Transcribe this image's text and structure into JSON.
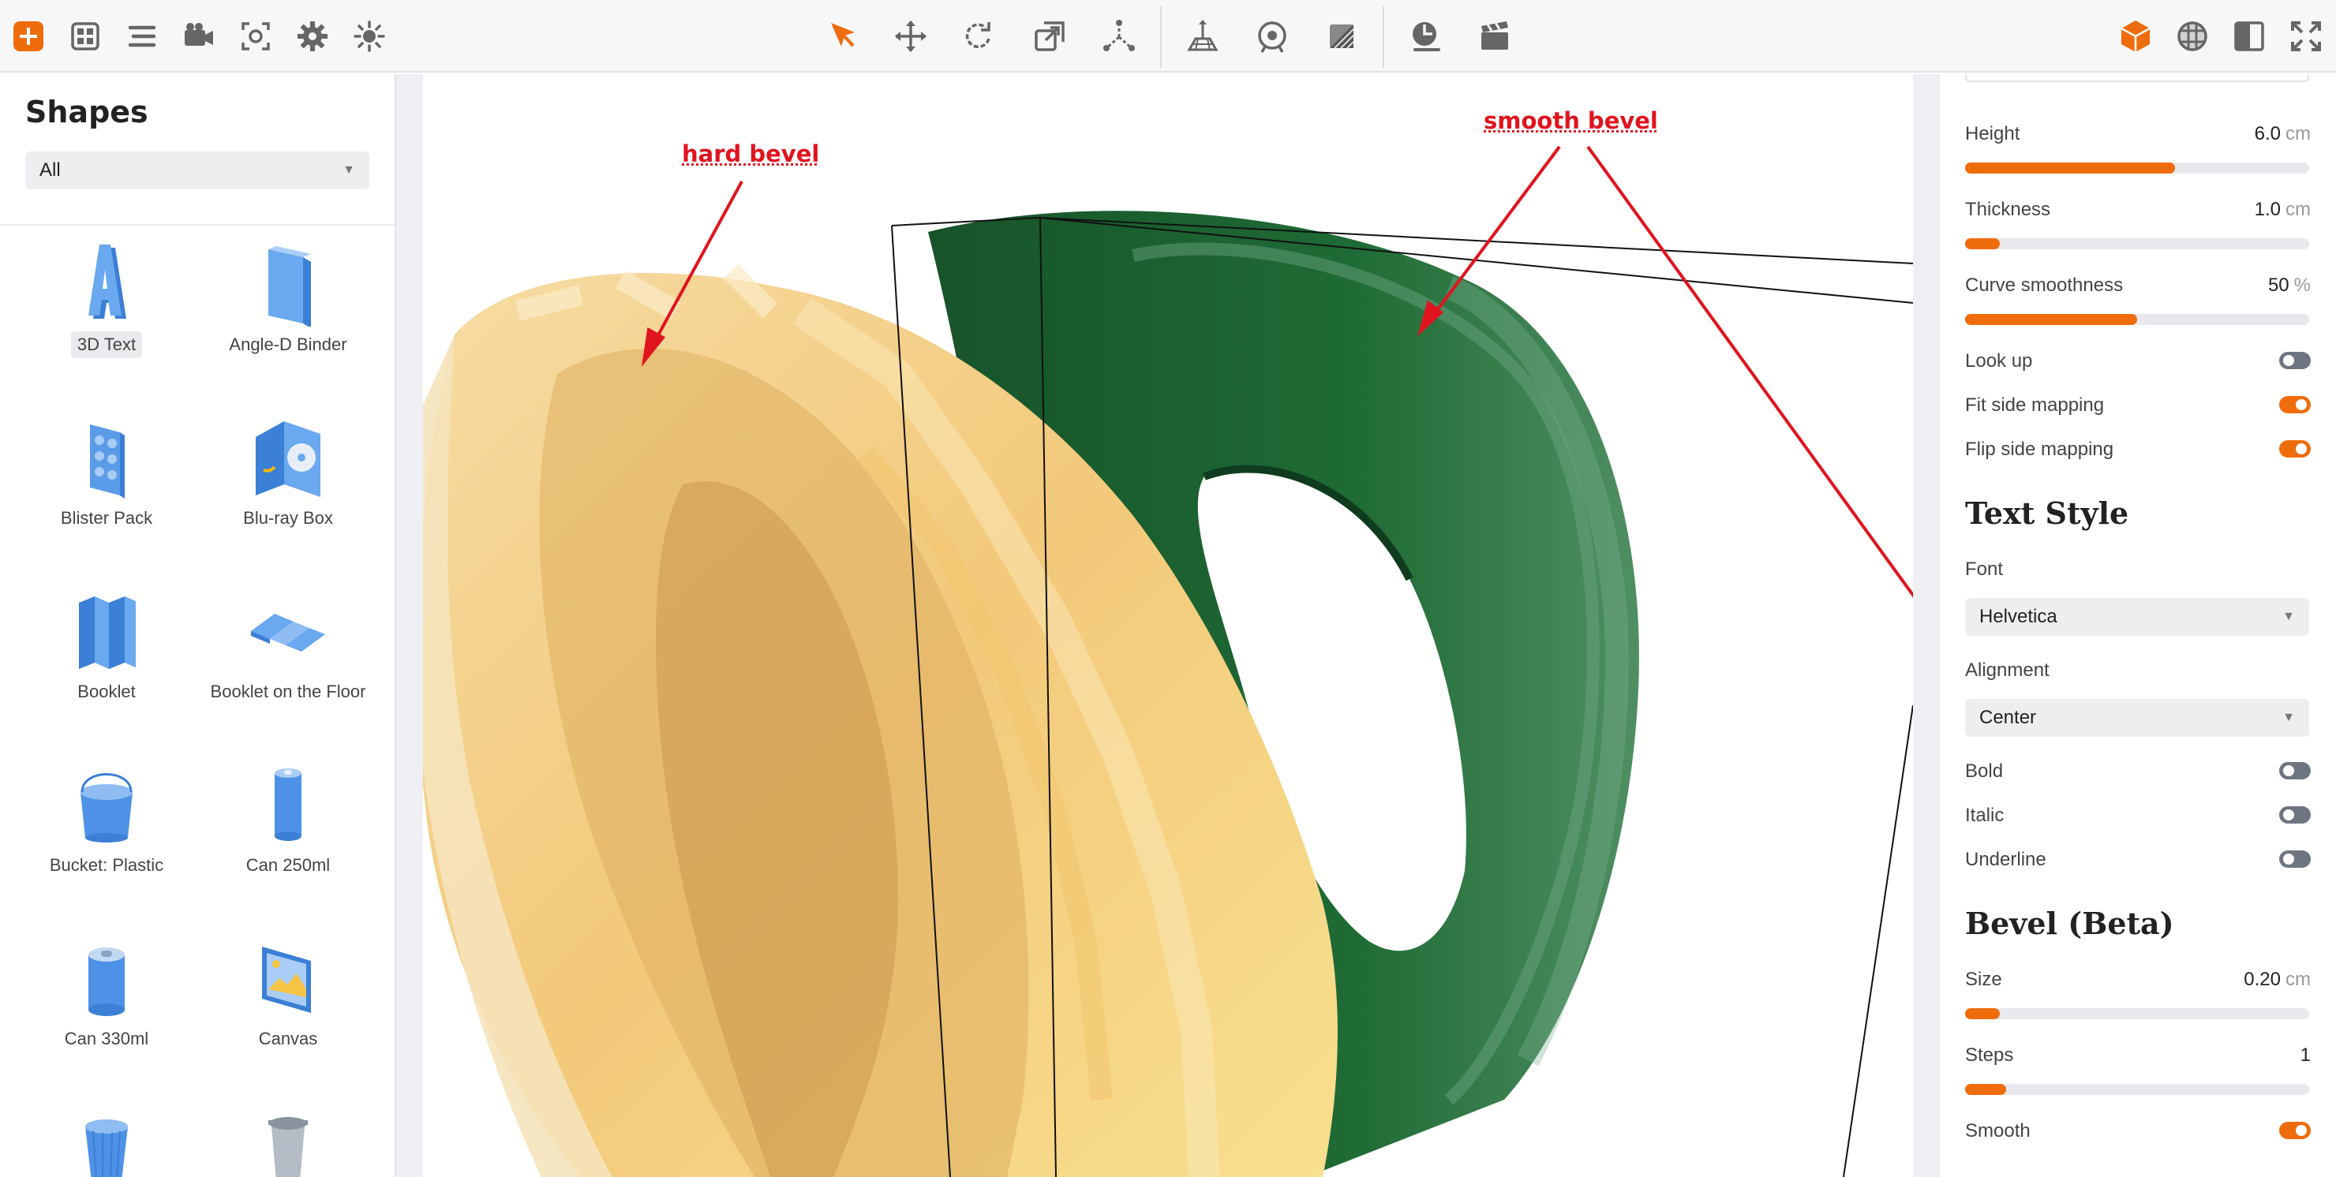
{
  "toolbar": {
    "left_tools": [
      "add-icon",
      "grid-icon",
      "layers-icon",
      "camera-icon",
      "focus-icon",
      "gear-icon",
      "light-icon"
    ],
    "center_tools": [
      "select-icon",
      "move-icon",
      "rotate-icon",
      "scale-icon",
      "pivot-icon",
      "ground-icon",
      "camera-orbit-icon",
      "material-icon",
      "timer-icon",
      "clapper-icon"
    ],
    "right_tools": [
      "cube-icon",
      "environment-icon",
      "panel-icon",
      "fullscreen-icon"
    ],
    "accent": "#ef6c0c"
  },
  "left_panel": {
    "title": "Shapes",
    "filter": {
      "value": "All"
    },
    "items": [
      {
        "label": "3D Text",
        "icon": "text-3d-icon",
        "selected": true
      },
      {
        "label": "Angle-D Binder",
        "icon": "binder-icon",
        "selected": false
      },
      {
        "label": "Blister Pack",
        "icon": "blister-pack-icon",
        "selected": false
      },
      {
        "label": "Blu-ray Box",
        "icon": "bluray-box-icon",
        "selected": false
      },
      {
        "label": "Booklet",
        "icon": "booklet-icon",
        "selected": false
      },
      {
        "label": "Booklet on the Floor",
        "icon": "booklet-floor-icon",
        "selected": false
      },
      {
        "label": "Bucket: Plastic",
        "icon": "bucket-icon",
        "selected": false
      },
      {
        "label": "Can 250ml",
        "icon": "can-250-icon",
        "selected": false
      },
      {
        "label": "Can 330ml",
        "icon": "can-330-icon",
        "selected": false
      },
      {
        "label": "Canvas",
        "icon": "canvas-icon",
        "selected": false
      },
      {
        "label": "",
        "icon": "cup-icon",
        "selected": false
      },
      {
        "label": "",
        "icon": "coffee-cup-icon",
        "selected": false
      }
    ]
  },
  "viewport": {
    "annotations": {
      "hard": "hard bevel",
      "smooth": "smooth bevel"
    },
    "colors": {
      "yellow": "#f3c97a",
      "green": "#1f6b35",
      "annotation": "#e0141e"
    }
  },
  "right_panel": {
    "height": {
      "label": "Height",
      "value": "6.0",
      "unit": "cm",
      "fraction": 0.61
    },
    "thickness": {
      "label": "Thickness",
      "value": "1.0",
      "unit": "cm",
      "fraction": 0.1
    },
    "curve": {
      "label": "Curve smoothness",
      "value": "50",
      "unit": "%",
      "fraction": 0.5
    },
    "look_up": {
      "label": "Look up",
      "on": false
    },
    "fit_side": {
      "label": "Fit side mapping",
      "on": true
    },
    "flip_side": {
      "label": "Flip side mapping",
      "on": true
    },
    "text_style": {
      "title": "Text Style",
      "font_label": "Font",
      "font_value": "Helvetica",
      "alignment_label": "Alignment",
      "alignment_value": "Center",
      "bold": {
        "label": "Bold",
        "on": false
      },
      "italic": {
        "label": "Italic",
        "on": false
      },
      "underline": {
        "label": "Underline",
        "on": false
      }
    },
    "bevel": {
      "title": "Bevel (Beta)",
      "size": {
        "label": "Size",
        "value": "0.20",
        "unit": "cm",
        "fraction": 0.1
      },
      "steps": {
        "label": "Steps",
        "value": "1",
        "fraction": 0.12
      },
      "smooth": {
        "label": "Smooth",
        "on": true
      }
    }
  }
}
